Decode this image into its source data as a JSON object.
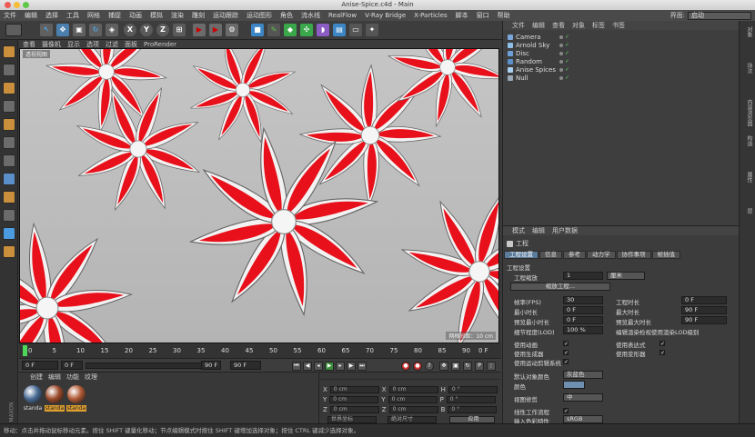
{
  "window": {
    "title": "Anise-Spice.c4d - Main"
  },
  "menubar": {
    "items": [
      "文件",
      "编辑",
      "选择",
      "工具",
      "网格",
      "捕捉",
      "动画",
      "模拟",
      "渲染",
      "雕刻",
      "运动跟踪",
      "运动图形",
      "角色",
      "流水线",
      "RealFlow",
      "V-Ray Bridge",
      "X-Particles",
      "脚本",
      "窗口",
      "帮助"
    ]
  },
  "layout": {
    "label": "界面:",
    "value": "启动"
  },
  "toolbar": {
    "x_label": "X",
    "y_label": "Y",
    "z_label": "Z"
  },
  "viewport": {
    "menu": [
      "查看",
      "摄像机",
      "显示",
      "选项",
      "过滤",
      "面板",
      "ProRender"
    ],
    "view_label": "透视视图",
    "grid_size": "网格间距：10 cm"
  },
  "timeline": {
    "ticks": [
      "0",
      "5",
      "10",
      "15",
      "20",
      "25",
      "30",
      "35",
      "40",
      "45",
      "50",
      "55",
      "60",
      "65",
      "70",
      "75",
      "80",
      "85",
      "90"
    ],
    "end_label": "0 F"
  },
  "transport": {
    "start_frame": "0 F",
    "current_frame": "0 F",
    "end_frame": "90 F",
    "end_frame2": "90 F"
  },
  "materials": {
    "menu": [
      "创建",
      "编辑",
      "功能",
      "纹理"
    ],
    "items": [
      {
        "label": "standa",
        "color": "#4a6b95"
      },
      {
        "label": "standa",
        "color": "#9a4a2a"
      },
      {
        "label": "standa",
        "color": "#b05a35"
      }
    ]
  },
  "coords": {
    "rows": [
      {
        "a_label": "X",
        "a_value": "0 cm",
        "b_label": "X",
        "b_value": "0 cm",
        "c_label": "H",
        "c_value": "0 °"
      },
      {
        "a_label": "Y",
        "a_value": "0 cm",
        "b_label": "Y",
        "b_value": "0 cm",
        "c_label": "P",
        "c_value": "0 °"
      },
      {
        "a_label": "Z",
        "a_value": "0 cm",
        "b_label": "Z",
        "b_value": "0 cm",
        "c_label": "B",
        "c_value": "0 °"
      }
    ],
    "mode1": "世界坐标",
    "mode2": "绝对尺寸",
    "apply": "应用"
  },
  "object_manager": {
    "menu": [
      "文件",
      "编辑",
      "查看",
      "对象",
      "标签",
      "书签"
    ],
    "objects": [
      {
        "name": "Camera",
        "color": "#7aa7d8"
      },
      {
        "name": "Arnold Sky",
        "color": "#8cc0e8"
      },
      {
        "name": "Disc",
        "color": "#6da0d6"
      },
      {
        "name": "Random",
        "color": "#5a8fc9"
      },
      {
        "name": "Anise Spices",
        "color": "#a9d0f0"
      },
      {
        "name": "Null",
        "color": "#9aa8b8"
      }
    ]
  },
  "attributes": {
    "menu": [
      "模式",
      "编辑",
      "用户数据"
    ],
    "header": "工程",
    "tabs": [
      "工程设置",
      "信息",
      "参考",
      "动力学",
      "协作事项",
      "帧插值"
    ],
    "section": "工程设置",
    "scale_label": "工程缩放",
    "scale_value": "1",
    "scale_unit": "厘米",
    "scale_button": "缩放工程...",
    "rows_left": [
      {
        "label": "帧率(FPS)",
        "value": "30"
      },
      {
        "label": "最小时长",
        "value": "0 F"
      },
      {
        "label": "预览最小时长",
        "value": "0 F"
      },
      {
        "label": "细节程度(LOD)",
        "value": "100 %"
      }
    ],
    "rows_right": [
      {
        "label": "工程时长",
        "value": "0 F"
      },
      {
        "label": "最大时长",
        "value": "90 F"
      },
      {
        "label": "预览最大时长",
        "value": "90 F"
      }
    ],
    "lod_check": "编辑渲染检视使用渲染LOD级别",
    "checks_left": [
      "使用动画",
      "使用生成器",
      "使用运动剪辑系统"
    ],
    "checks_right": [
      "使用表达式",
      "使用变形器"
    ],
    "default_color_label": "默认对象颜色",
    "default_color_value": "灰蓝色",
    "color_label": "颜色",
    "preview_label": "视图修剪",
    "preview_value": "中",
    "linear_label": "线性工作流程",
    "input_profile_label": "输入色彩特性",
    "input_profile_value": "sRGB"
  },
  "right_tabs": [
    "对象",
    "场次",
    "内容浏览器",
    "构造",
    "属性",
    "层"
  ],
  "status": {
    "text": "移动：点击并拖动鼠标移动元素。按住 SHIFT 键量化移动；节点编辑模式时按住 SHIFT 键增加选择对象；按住 CTRL 键减少选择对象。"
  }
}
